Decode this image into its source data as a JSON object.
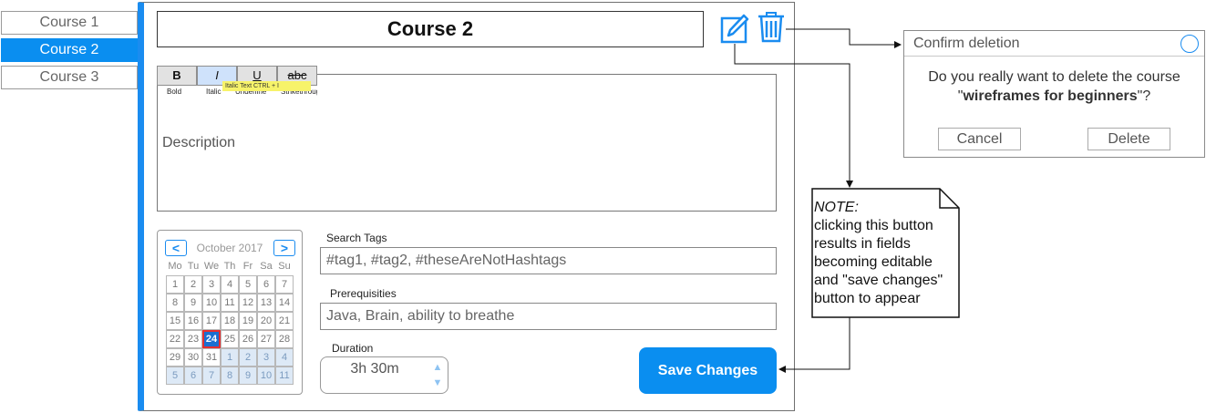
{
  "sidebar": {
    "items": [
      {
        "label": "Course 1"
      },
      {
        "label": "Course 2"
      },
      {
        "label": "Course 3"
      }
    ],
    "active_index": 1,
    "accent_color": "#0a8ef0"
  },
  "course": {
    "title": "Course 2",
    "edit_icon": "pencil-square-icon",
    "delete_icon": "trash-icon"
  },
  "editor": {
    "toolbar": [
      {
        "label": "B",
        "caption": "Bold"
      },
      {
        "label": "I",
        "caption": "Italic"
      },
      {
        "label": "U",
        "caption": "Underline"
      },
      {
        "label": "abc",
        "caption": "Strikethrough"
      }
    ],
    "tooltip": "Italic Text CTRL + I",
    "description_placeholder": "Description"
  },
  "calendar": {
    "prev_label": "<",
    "next_label": ">",
    "month_label": "October 2017",
    "weekdays": [
      "Mo",
      "Tu",
      "We",
      "Th",
      "Fr",
      "Sa",
      "Su"
    ],
    "days": [
      [
        "1",
        "2",
        "3",
        "4",
        "5",
        "6",
        "7"
      ],
      [
        "8",
        "9",
        "10",
        "11",
        "12",
        "13",
        "14"
      ],
      [
        "15",
        "16",
        "17",
        "18",
        "19",
        "20",
        "21"
      ],
      [
        "22",
        "23",
        "24",
        "25",
        "26",
        "27",
        "28"
      ],
      [
        "29",
        "30",
        "31",
        "1",
        "2",
        "3",
        "4"
      ],
      [
        "5",
        "6",
        "7",
        "8",
        "9",
        "10",
        "11"
      ]
    ],
    "selected_day": "24"
  },
  "fields": {
    "tags_label": "Search Tags",
    "tags_value": "#tag1, #tag2, #theseAreNotHashtags",
    "prereq_label": "Prerequisities",
    "prereq_value": "Java, Brain, ability to breathe",
    "duration_label": "Duration",
    "duration_value": "3h 30m"
  },
  "save_button": {
    "label": "Save Changes"
  },
  "dialog": {
    "title": "Confirm deletion",
    "message_prefix": "Do you really want to delete the course",
    "course_name": "wireframes for beginners",
    "message_suffix": "?",
    "cancel_label": "Cancel",
    "delete_label": "Delete"
  },
  "note": {
    "heading": "NOTE:",
    "lines": [
      "clicking this button",
      "results in fields",
      "becoming editable",
      "and \"save changes\"",
      "button to appear"
    ]
  }
}
